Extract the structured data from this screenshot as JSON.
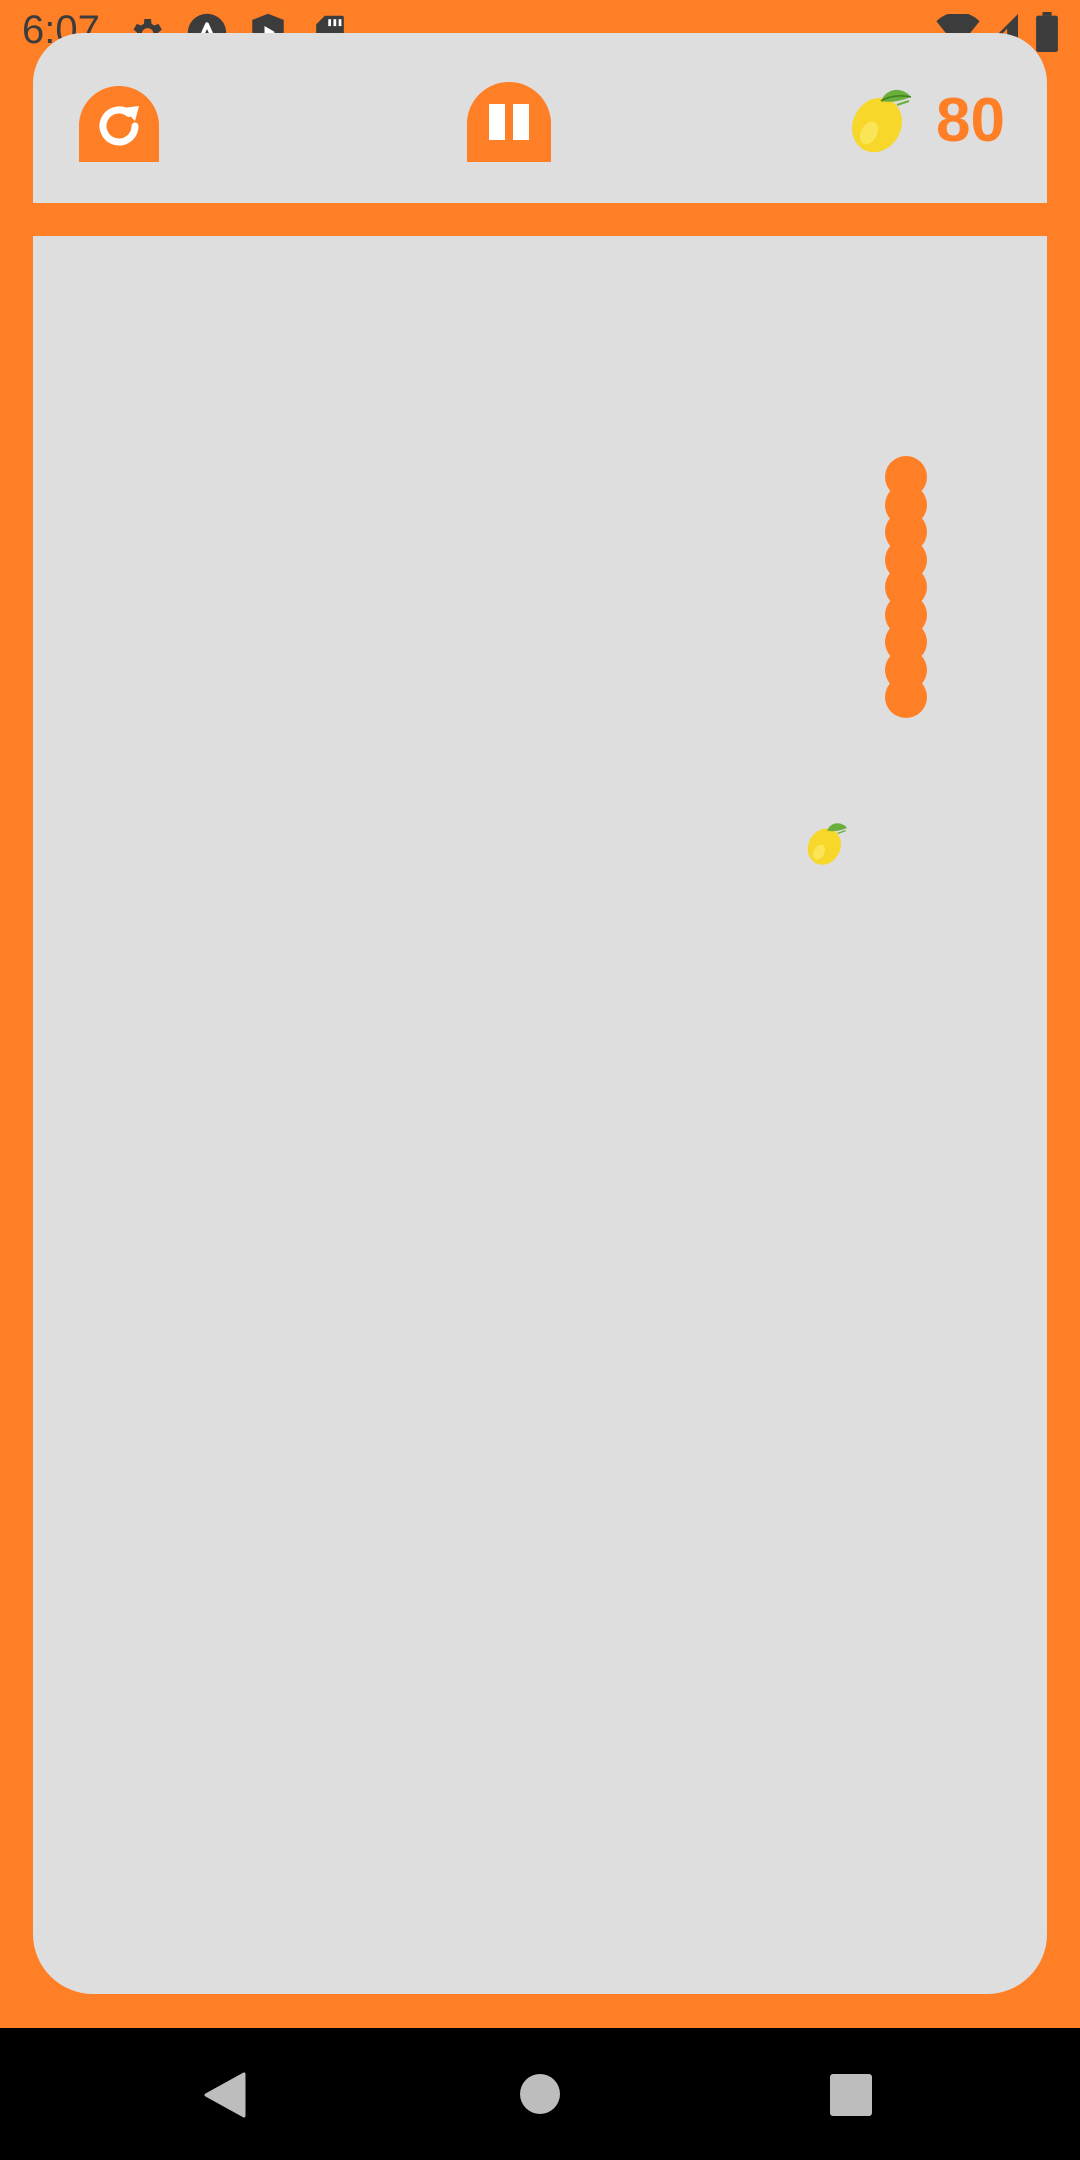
{
  "status_bar": {
    "time": "6:07",
    "left_icons": [
      "settings-gear-icon",
      "a-circle-icon",
      "shield-play-icon",
      "sd-card-icon"
    ],
    "right_icons": [
      "wifi-icon",
      "cell-signal-icon",
      "battery-icon"
    ]
  },
  "header": {
    "restart_icon": "restart-icon",
    "pause_icon": "pause-icon",
    "score_icon": "lemon-icon",
    "score": "80"
  },
  "game": {
    "snake_color": "#FF7F27",
    "snake_length": 9,
    "food_icon": "lemon-icon"
  },
  "nav": {
    "back": "back-icon",
    "home": "home-icon",
    "recents": "recents-icon"
  },
  "colors": {
    "accent": "#FF7F27",
    "panel": "#DEDEDE",
    "navbar": "#000000"
  }
}
